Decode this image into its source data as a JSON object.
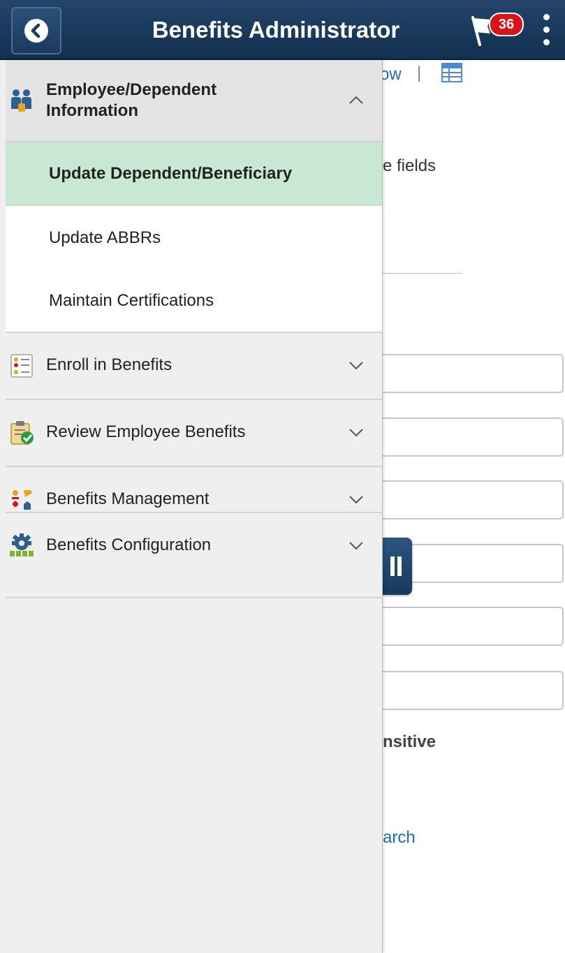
{
  "header": {
    "title": "Benefits Administrator",
    "notification_count": "36",
    "colors": {
      "bar": "#1b3b5f",
      "badge": "#d8141a"
    }
  },
  "background_page": {
    "fragment_top": "ow",
    "separator": "|",
    "fragment_fields": "e fields",
    "fragment_sensitive": "nsitive",
    "fragment_search": "arch"
  },
  "sidenav": {
    "open_group": {
      "label": "Employee/Dependent Information",
      "icon": "people-icon",
      "items": [
        {
          "label": "Update Dependent/Beneficiary",
          "selected": true
        },
        {
          "label": "Update ABBRs",
          "selected": false
        },
        {
          "label": "Maintain Certifications",
          "selected": false
        }
      ]
    },
    "groups": [
      {
        "label": "Enroll in Benefits",
        "icon": "enroll-list-icon"
      },
      {
        "label": "Review Employee Benefits",
        "icon": "clipboard-check-icon"
      },
      {
        "label": "Benefits Management",
        "icon": "benefits-management-icon"
      },
      {
        "label": "Benefits Configuration",
        "icon": "gear-config-icon"
      }
    ],
    "selected_color": "#c9e8d4"
  }
}
